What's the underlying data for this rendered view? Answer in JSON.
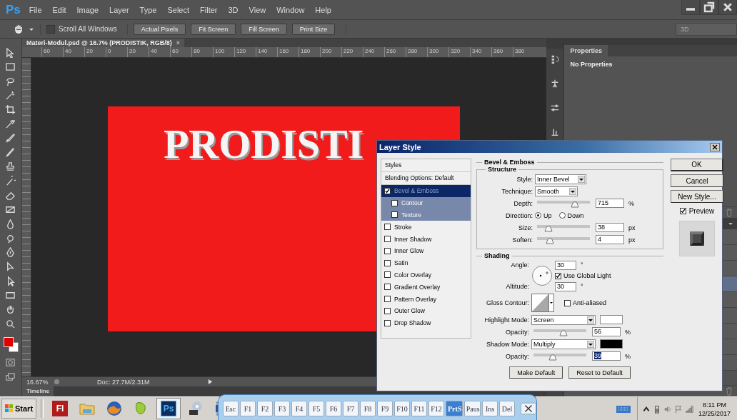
{
  "app": {
    "logo": "Ps",
    "menu": [
      "File",
      "Edit",
      "Image",
      "Layer",
      "Type",
      "Select",
      "Filter",
      "3D",
      "View",
      "Window",
      "Help"
    ]
  },
  "options_bar": {
    "scroll_all": {
      "label": "Scroll All Windows",
      "checked": false
    },
    "buttons": [
      "Actual Pixels",
      "Fit Screen",
      "Fill Screen",
      "Print Size"
    ],
    "workspace": "3D"
  },
  "document": {
    "tab": "Materi-Modul.psd @ 16.7% (PRODISTIK, RGB/8)",
    "close": "×",
    "ruler": [
      "60",
      "40",
      "20",
      "0",
      "20",
      "40",
      "60",
      "80",
      "100",
      "120",
      "140",
      "160",
      "180",
      "200",
      "220",
      "240",
      "260",
      "280",
      "300",
      "320",
      "340",
      "360",
      "380"
    ],
    "canvas_text": "PRODISTI",
    "zoom": "16.67%",
    "doc_info": "Doc: 27.7M/2.31M",
    "timeline": "Timeline"
  },
  "properties": {
    "tab": "Properties",
    "message": "No Properties"
  },
  "layers_panel": {
    "rows": [
      {
        "selected": false
      },
      {
        "selected": false
      },
      {
        "selected": false
      },
      {
        "selected": true
      },
      {
        "selected": false
      },
      {
        "selected": false
      },
      {
        "selected": false
      },
      {
        "selected": false
      },
      {
        "selected": false
      }
    ]
  },
  "layer_style": {
    "title": "Layer Style",
    "styles": {
      "header": "Styles",
      "blending": "Blending Options: Default",
      "items": [
        {
          "label": "Bevel & Emboss",
          "checked": true,
          "selected": true,
          "children": [
            {
              "label": "Contour",
              "checked": false,
              "selected": false
            },
            {
              "label": "Texture",
              "checked": false,
              "selected": false
            }
          ]
        },
        {
          "label": "Stroke",
          "checked": false,
          "selected": false
        },
        {
          "label": "Inner Shadow",
          "checked": false,
          "selected": false
        },
        {
          "label": "Inner Glow",
          "checked": false,
          "selected": false
        },
        {
          "label": "Satin",
          "checked": false,
          "selected": false
        },
        {
          "label": "Color Overlay",
          "checked": false,
          "selected": false
        },
        {
          "label": "Gradient Overlay",
          "checked": false,
          "selected": false
        },
        {
          "label": "Pattern Overlay",
          "checked": false,
          "selected": false
        },
        {
          "label": "Outer Glow",
          "checked": false,
          "selected": false
        },
        {
          "label": "Drop Shadow",
          "checked": false,
          "selected": false
        }
      ]
    },
    "group": "Bevel & Emboss",
    "structure": {
      "legend": "Structure",
      "rows": [
        {
          "kind": "select",
          "label": "Style:",
          "value": "Inner Bevel"
        },
        {
          "kind": "select",
          "label": "Technique:",
          "value": "Smooth"
        },
        {
          "kind": "slider",
          "label": "Depth:",
          "level": 0.71,
          "value": "715",
          "unit": "%",
          "highlighted": false
        },
        {
          "kind": "radio",
          "label": "Direction:",
          "options": [
            {
              "label": "Up",
              "selected": true
            },
            {
              "label": "Down",
              "selected": false
            }
          ]
        },
        {
          "kind": "slider",
          "label": "Size:",
          "level": 0.21,
          "value": "38",
          "unit": "px",
          "highlighted": false
        },
        {
          "kind": "slider",
          "label": "Soften:",
          "level": 0.24,
          "value": "4",
          "unit": "px",
          "highlighted": false
        }
      ]
    },
    "shading": {
      "legend": "Shading",
      "angle": {
        "label": "Angle:",
        "value": "30",
        "unit": "°"
      },
      "global_light": {
        "label": "Use Global Light",
        "checked": true
      },
      "altitude": {
        "label": "Altitude:",
        "value": "30",
        "unit": "°"
      },
      "gloss": {
        "label": "Gloss Contour:",
        "anti_aliased": {
          "label": "Anti-aliased",
          "checked": false
        }
      },
      "rows": [
        {
          "kind": "mode",
          "label": "Highlight Mode:",
          "value": "Screen",
          "color": "#ffffff"
        },
        {
          "kind": "slider",
          "label": "Opacity:",
          "level": 0.57,
          "value": "56",
          "unit": "%",
          "highlighted": false
        },
        {
          "kind": "mode",
          "label": "Shadow Mode:",
          "value": "Multiply",
          "color": "#000000"
        },
        {
          "kind": "slider",
          "label": "Opacity:",
          "level": 0.37,
          "value": "39",
          "unit": "%",
          "highlighted": true
        }
      ]
    },
    "bottom_buttons": [
      "Make Default",
      "Reset to Default"
    ],
    "side_buttons": [
      "OK",
      "Cancel",
      "New Style..."
    ],
    "preview": {
      "label": "Preview",
      "checked": true
    }
  },
  "taskbar": {
    "start": "Start",
    "apps": [
      {
        "kind": "badge",
        "label": "Fl",
        "selected": false
      },
      {
        "kind": "folder",
        "selected": false
      },
      {
        "kind": "browser",
        "selected": false
      },
      {
        "kind": "vector",
        "selected": false
      },
      {
        "kind": "badge",
        "label": "Ps",
        "selected": true
      },
      {
        "kind": "media",
        "selected": false
      },
      {
        "kind": "document",
        "selected": false
      }
    ],
    "keys": [
      {
        "label": "Esc",
        "on": false
      },
      {
        "label": "F1",
        "on": false
      },
      {
        "label": "F2",
        "on": false
      },
      {
        "label": "F3",
        "on": false
      },
      {
        "label": "F4",
        "on": false
      },
      {
        "label": "F5",
        "on": false
      },
      {
        "label": "F6",
        "on": false
      },
      {
        "label": "F7",
        "on": false
      },
      {
        "label": "F8",
        "on": false
      },
      {
        "label": "F9",
        "on": false
      },
      {
        "label": "F10",
        "on": false
      },
      {
        "label": "F11",
        "on": false
      },
      {
        "label": "F12",
        "on": false
      },
      {
        "label": "PrtS",
        "on": true
      },
      {
        "label": "Paus",
        "on": false
      },
      {
        "label": "Ins",
        "on": false
      },
      {
        "label": "Del",
        "on": false
      }
    ],
    "clock": {
      "time": "8:11 PM",
      "date": "12/25/2017"
    }
  }
}
